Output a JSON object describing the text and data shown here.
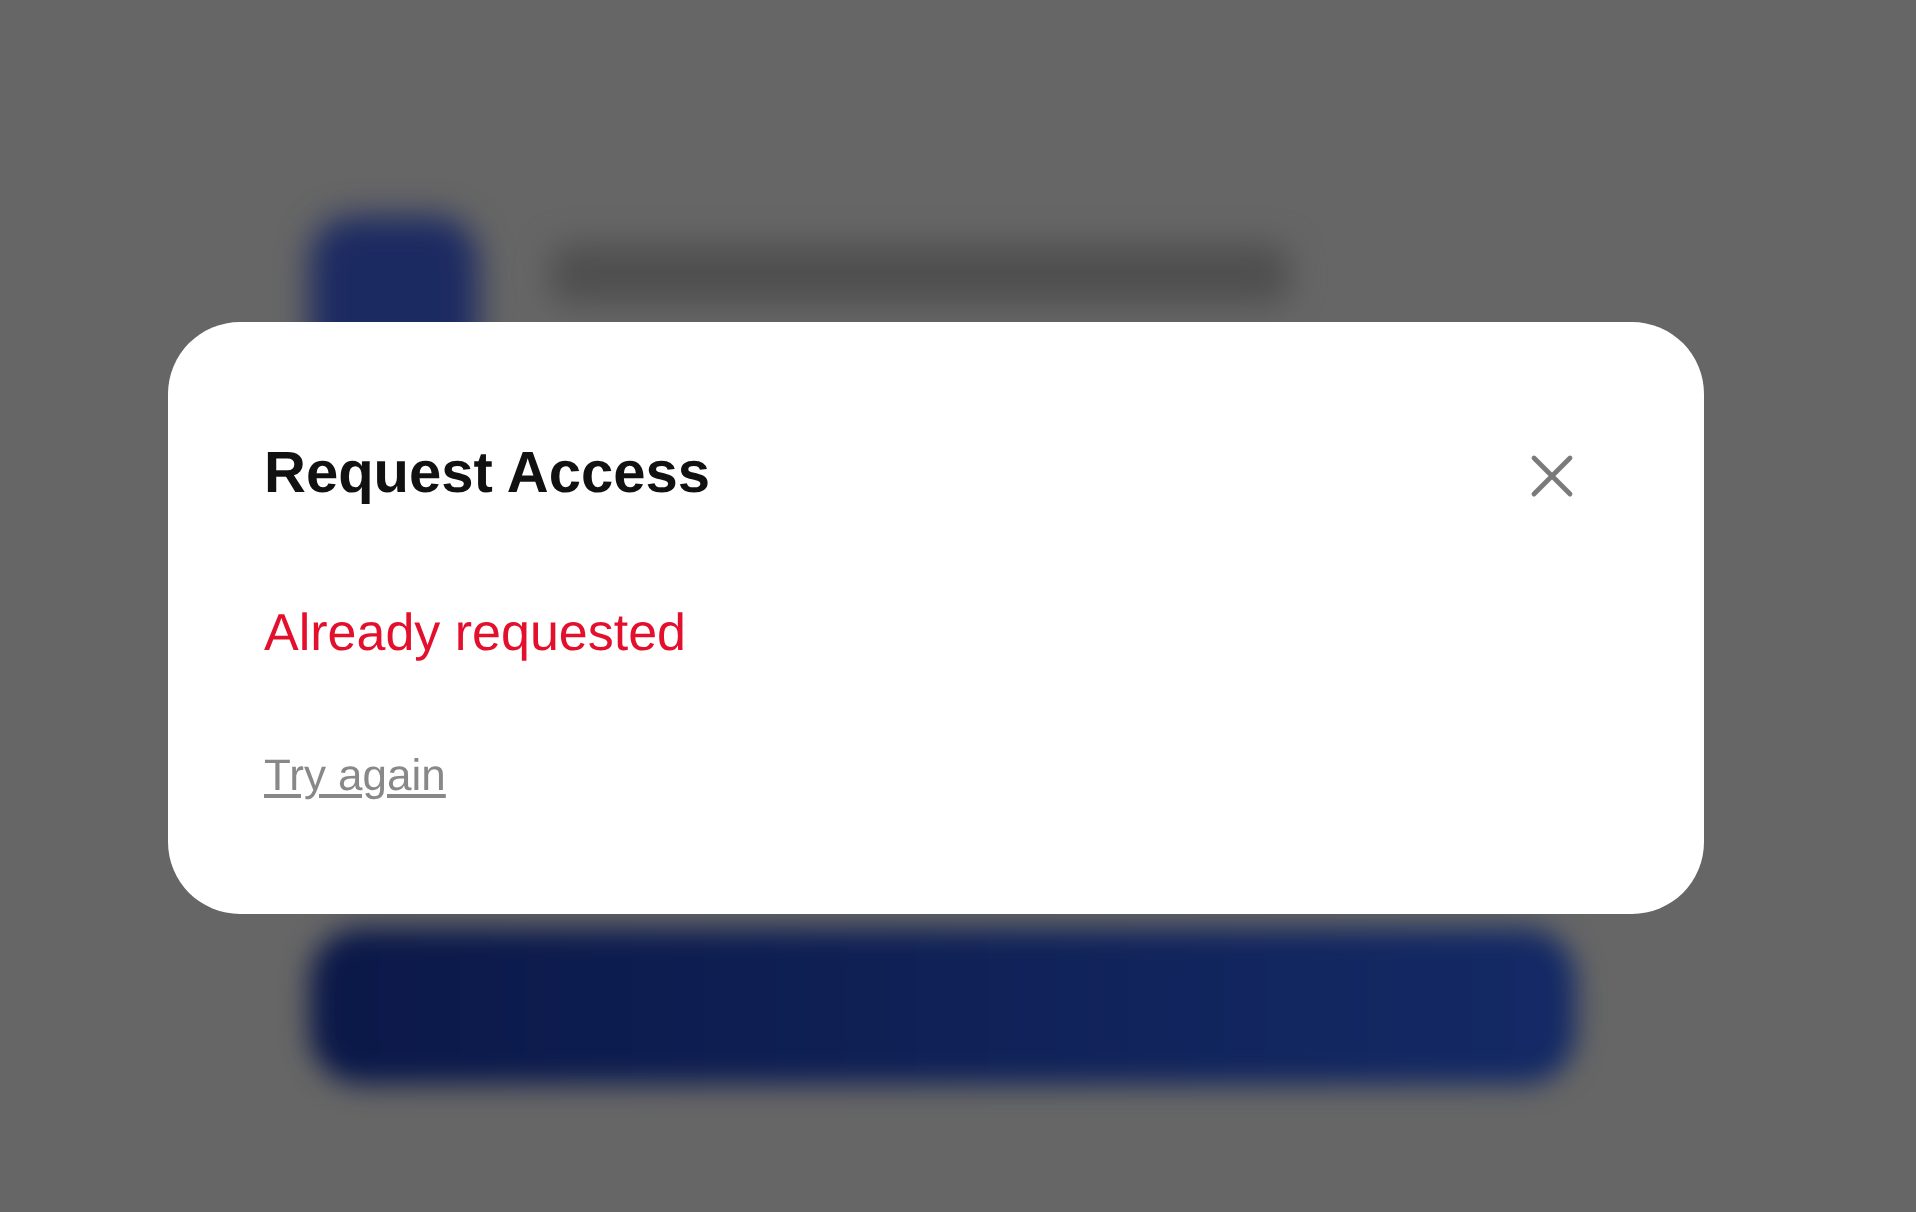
{
  "dialog": {
    "title": "Request Access",
    "error": "Already requested",
    "retry_link": "Try again"
  }
}
